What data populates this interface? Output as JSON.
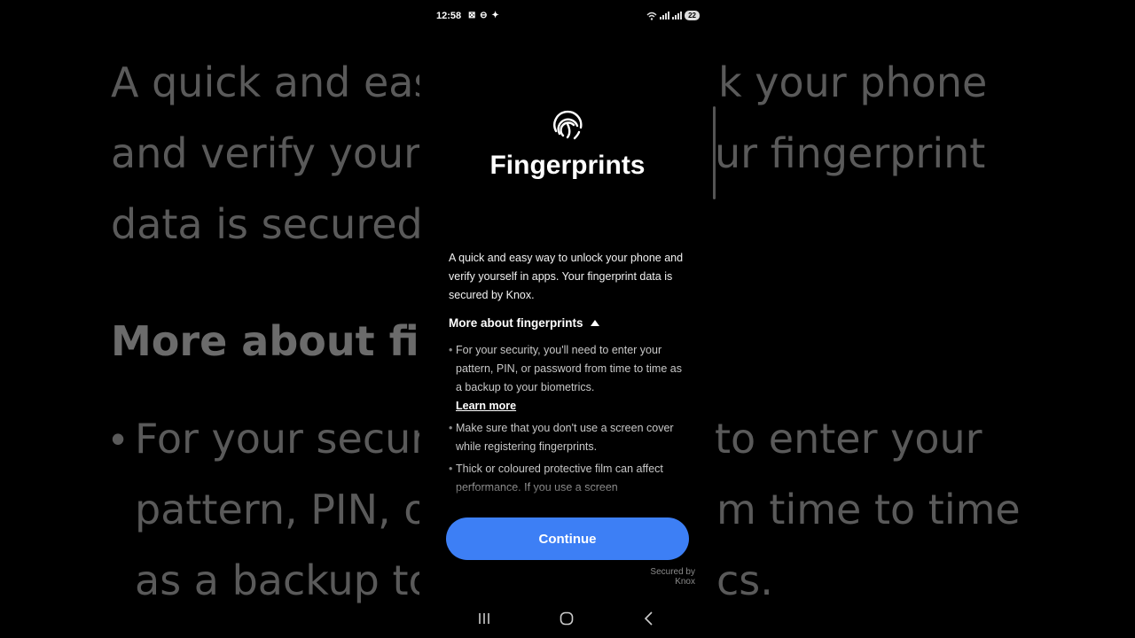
{
  "background": {
    "lines": [
      "A quick and eas",
      "k your phone",
      "and verify yours",
      "ur fingerprint",
      "data is secured",
      "More about fir",
      "For your secur",
      "to enter your",
      "pattern, PIN, o",
      "m time to time",
      "as a backup to",
      "cs."
    ]
  },
  "status_bar": {
    "time": "12:58",
    "left_icons": "⊠ ⊖ ✦",
    "battery": "22"
  },
  "header": {
    "icon": "fingerprint-icon",
    "title": "Fingerprints"
  },
  "description": "A quick and easy way to unlock your phone and verify yourself in apps. Your fingerprint data is secured by Knox.",
  "more_section": {
    "label": "More about fingerprints",
    "tips": [
      "For your security, you'll need to enter your pattern, PIN, or password from time to time as a backup to your biometrics.",
      "Make sure that you don't use a screen cover while registering fingerprints.",
      "Thick or coloured protective film can affect performance. If you use a screen"
    ],
    "learn_more": "Learn more"
  },
  "continue_label": "Continue",
  "knox_label": {
    "line1": "Secured by",
    "line2": "Knox"
  },
  "colors": {
    "accent": "#3d7ff5",
    "background": "#000000"
  }
}
